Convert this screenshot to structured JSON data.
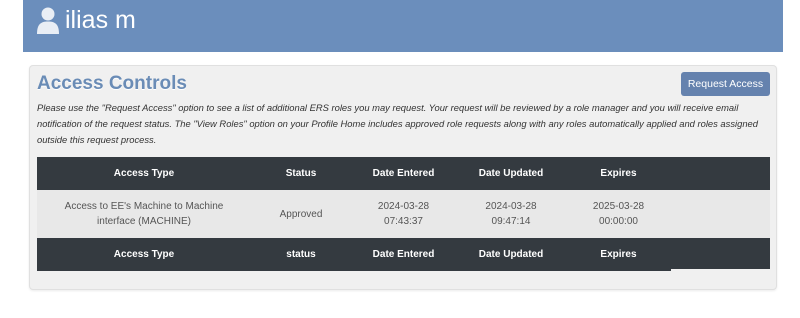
{
  "header": {
    "user_name": "ilias m",
    "bg_color": "#6b8ebc"
  },
  "panel": {
    "title": "Access Controls",
    "request_button": "Request Access",
    "description": "Please use the \"Request Access\" option to see a list of additional ERS roles you may request. Your request will be reviewed by a role manager and you will receive email notification of the request status. The \"View Roles\" option on your Profile Home includes approved role requests along with any roles automatically applied and roles assigned outside this request process."
  },
  "table": {
    "headers": [
      "Access Type",
      "Status",
      "Date Entered",
      "Date Updated",
      "Expires"
    ],
    "rows": [
      {
        "access_type": "Access to EE's Machine to Machine interface (MACHINE)",
        "status": "Approved",
        "date_entered": "2024-03-28\n07:43:37",
        "date_updated": "2024-03-28\n09:47:14",
        "expires": "2025-03-28\n00:00:00"
      }
    ],
    "footer_headers": [
      "Access Type",
      "status",
      "Date Entered",
      "Date Updated",
      "Expires"
    ]
  },
  "colors": {
    "header_row": "#343a40",
    "button": "#6582ae",
    "title": "#6a8cb6"
  }
}
